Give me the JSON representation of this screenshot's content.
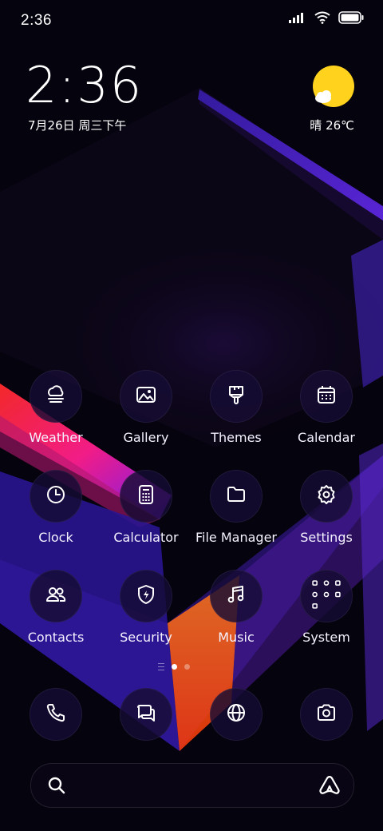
{
  "status_bar": {
    "time": "2:36"
  },
  "clock_widget": {
    "time": "2:36",
    "date": "7月26日 周三下午"
  },
  "weather_widget": {
    "text": "晴 26℃",
    "icon": "sun-cloud-icon"
  },
  "apps": [
    {
      "label": "Weather",
      "icon": "cloud-fog-icon"
    },
    {
      "label": "Gallery",
      "icon": "image-icon"
    },
    {
      "label": "Themes",
      "icon": "paint-brush-icon"
    },
    {
      "label": "Calendar",
      "icon": "calendar-icon"
    },
    {
      "label": "Clock",
      "icon": "clock-icon"
    },
    {
      "label": "Calculator",
      "icon": "calculator-icon"
    },
    {
      "label": "File Manager",
      "icon": "folder-icon"
    },
    {
      "label": "Settings",
      "icon": "gear-icon"
    },
    {
      "label": "Contacts",
      "icon": "contacts-icon"
    },
    {
      "label": "Security",
      "icon": "shield-bolt-icon"
    },
    {
      "label": "Music",
      "icon": "music-note-icon"
    },
    {
      "label": "System",
      "icon": "folder-grid-icon"
    }
  ],
  "page_indicator": {
    "pages": 2,
    "active_page": 1
  },
  "dock": [
    {
      "icon": "phone-icon"
    },
    {
      "icon": "messages-icon"
    },
    {
      "icon": "browser-globe-icon"
    },
    {
      "icon": "camera-icon"
    }
  ],
  "search_bar": {
    "value": "",
    "placeholder": ""
  },
  "colors": {
    "background": "#05030d",
    "icon_bg": "#160c34",
    "weather_sun": "#ffd21e"
  }
}
